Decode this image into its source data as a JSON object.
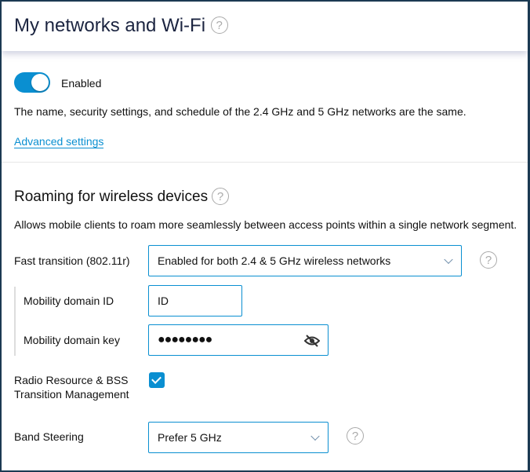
{
  "header": {
    "title": "My networks and Wi-Fi",
    "help_icon": "?"
  },
  "wifi": {
    "toggle_on": true,
    "toggle_label": "Enabled",
    "description": "The name, security settings, and schedule of the 2.4 GHz and 5 GHz networks are the same.",
    "advanced_link": "Advanced settings"
  },
  "roaming": {
    "title": "Roaming for wireless devices",
    "description": "Allows mobile clients to roam more seamlessly between access points within a single network segment.",
    "fast_transition": {
      "label": "Fast transition (802.11r)",
      "value": "Enabled for both 2.4 & 5 GHz wireless networks"
    },
    "mobility_domain_id": {
      "label": "Mobility domain ID",
      "value": "ID"
    },
    "mobility_domain_key": {
      "label": "Mobility domain key",
      "value": "●●●●●●●●"
    },
    "rrm": {
      "label_line1": "Radio Resource & BSS",
      "label_line2": "Transition Management",
      "checked": true
    },
    "band_steering": {
      "label": "Band Steering",
      "value": "Prefer 5 GHz"
    }
  },
  "colors": {
    "accent": "#0a8fd1",
    "border": "#1b3a52"
  }
}
